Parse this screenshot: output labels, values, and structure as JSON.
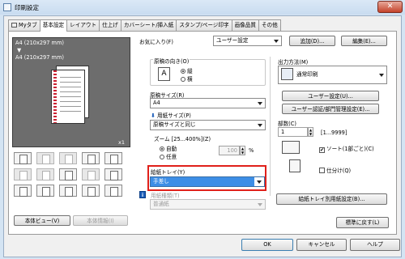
{
  "window": {
    "title": "印刷設定",
    "close_glyph": "✕"
  },
  "tabs": [
    {
      "label": "Myタブ",
      "active": false,
      "has_icon": true
    },
    {
      "label": "基本設定",
      "active": true
    },
    {
      "label": "レイアウト",
      "active": false
    },
    {
      "label": "仕上げ",
      "active": false
    },
    {
      "label": "カバーシート/挿入紙",
      "active": false
    },
    {
      "label": "スタンプ/ページ印字",
      "active": false
    },
    {
      "label": "画像品質",
      "active": false
    },
    {
      "label": "その他",
      "active": false
    }
  ],
  "preview": {
    "line1": "A4 (210x297 mm)",
    "arrow": "▼",
    "line2": "A4 (210x297 mm)",
    "scale": "x1"
  },
  "left_buttons": {
    "view": "本体ビュー(V)",
    "info": "本体情報(I)"
  },
  "favorites": {
    "label": "お気に入り(F)",
    "value": "ユーザー設定",
    "add": "追加(D)...",
    "edit": "編集(E)..."
  },
  "orientation": {
    "label": "原稿の向き(O)",
    "portrait": "縦",
    "landscape": "横",
    "selected": "縦"
  },
  "original_size": {
    "label": "原稿サイズ(R)",
    "value": "A4"
  },
  "paper_size": {
    "label": "用紙サイズ(P)",
    "value": "原稿サイズと同じ"
  },
  "zoom": {
    "label": "ズーム [25...400%](Z)",
    "auto": "自動",
    "manual": "任意",
    "selected": "自動",
    "value": "100",
    "unit": "%"
  },
  "paper_tray": {
    "label": "給紙トレイ(Y)",
    "value": "手差し"
  },
  "paper_type": {
    "label": "用紙種類(T)",
    "value": "普通紙"
  },
  "output": {
    "label": "出力方法(M)",
    "value": "通常印刷",
    "user_settings": "ユーザー設定(U)...",
    "auth": "ユーザー認証/部門管理設定(E)..."
  },
  "copies": {
    "label": "部数(C)",
    "value": "1",
    "range": "[1...9999]"
  },
  "collate": {
    "label": "ソート(1部ごと)(C)",
    "checked": true
  },
  "offset": {
    "label": "仕分け(Q)",
    "checked": false
  },
  "tray_settings_button": "給紙トレイ別用紙設定(B)...",
  "defaults_button": "標準に戻す(L)",
  "footer": {
    "ok": "OK",
    "cancel": "キャンセル",
    "help": "ヘルプ"
  }
}
